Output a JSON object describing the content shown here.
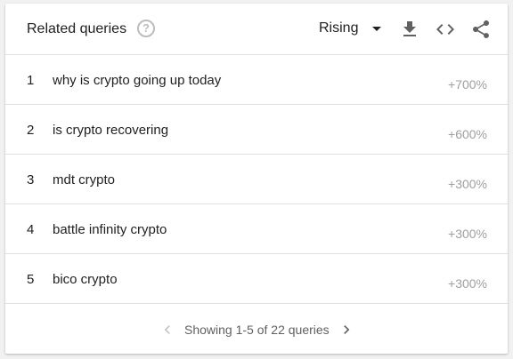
{
  "header": {
    "title": "Related queries",
    "help_glyph": "?",
    "sort_selected": "Rising",
    "icons": [
      "help-icon",
      "caret-down-icon",
      "download-icon",
      "embed-code-icon",
      "share-icon"
    ]
  },
  "rows": [
    {
      "rank": "1",
      "query": "why is crypto going up today",
      "value": "+700%"
    },
    {
      "rank": "2",
      "query": "is crypto recovering",
      "value": "+600%"
    },
    {
      "rank": "3",
      "query": "mdt crypto",
      "value": "+300%"
    },
    {
      "rank": "4",
      "query": "battle infinity crypto",
      "value": "+300%"
    },
    {
      "rank": "5",
      "query": "bico crypto",
      "value": "+300%"
    }
  ],
  "pagination": {
    "text": "Showing 1-5 of 22 queries"
  },
  "colors": {
    "text": "#212121",
    "muted": "#9e9e9e",
    "icon": "#616161",
    "disabled": "#c4c4c4",
    "divider": "#e0e0e0",
    "background": "#f1f1f1",
    "card": "#ffffff"
  }
}
